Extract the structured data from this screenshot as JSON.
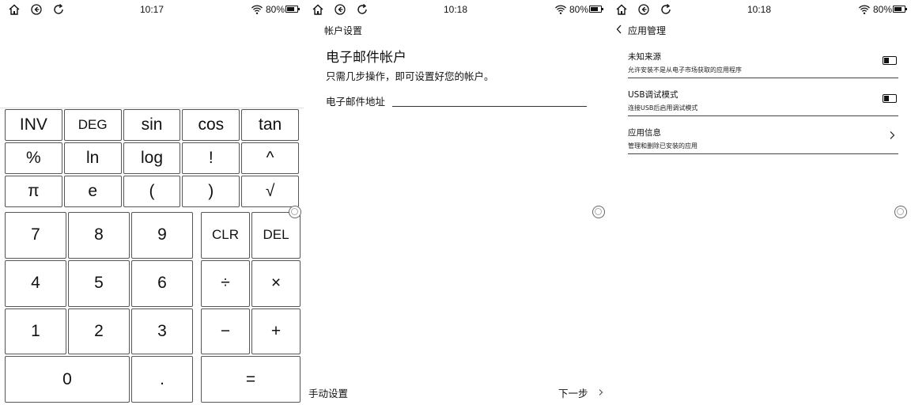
{
  "screens": [
    {
      "status": {
        "time": "10:17",
        "battery": "80%",
        "battery_level": 0.8
      },
      "calculator": {
        "scientific_keys": [
          [
            "INV",
            "DEG",
            "sin",
            "cos",
            "tan"
          ],
          [
            "%",
            "ln",
            "log",
            "!",
            "^"
          ],
          [
            "π",
            "e",
            "(",
            ")",
            "√"
          ]
        ],
        "number_keys": [
          "7",
          "8",
          "9",
          "4",
          "5",
          "6",
          "1",
          "2",
          "3",
          "0",
          "."
        ],
        "operator_keys": [
          "CLR",
          "DEL",
          "÷",
          "×",
          "−",
          "+",
          "="
        ]
      }
    },
    {
      "status": {
        "time": "10:18",
        "battery": "80%",
        "battery_level": 0.8
      },
      "account": {
        "page_title": "帐户设置",
        "heading": "电子邮件帐户",
        "subtitle": "只需几步操作，即可设置好您的帐户。",
        "email_label": "电子邮件地址",
        "email_value": "",
        "manual_setup": "手动设置",
        "next": "下一步"
      }
    },
    {
      "status": {
        "time": "10:18",
        "battery": "80%",
        "battery_level": 0.8
      },
      "app_management": {
        "page_title": "应用管理",
        "items": [
          {
            "title": "未知来源",
            "description": "允许安装不是从电子市场获取的应用程序",
            "control": "toggle",
            "enabled": false
          },
          {
            "title": "USB调试模式",
            "description": "连接USB后启用调试模式",
            "control": "toggle",
            "enabled": false
          },
          {
            "title": "应用信息",
            "description": "管理和删除已安装的应用",
            "control": "chevron"
          }
        ]
      }
    }
  ],
  "icons": {
    "status_bar": [
      "home-icon",
      "back-icon",
      "refresh-icon",
      "wifi-icon",
      "battery-icon"
    ],
    "side": "side-handle-icon",
    "app_back": "chevron-left-icon",
    "item_arrow": "chevron-right-icon",
    "next_arrow": "chevron-right-icon"
  }
}
